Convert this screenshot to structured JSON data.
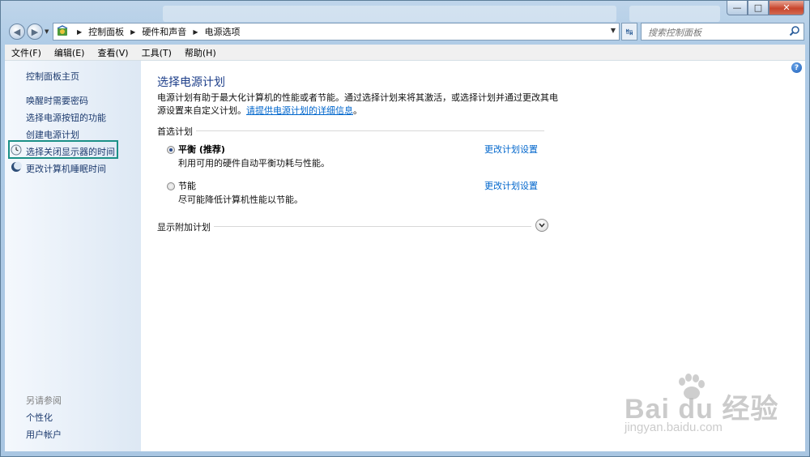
{
  "window": {
    "controls": {
      "minimize": "—",
      "maximize": "□",
      "close": "✕"
    }
  },
  "address": {
    "crumbs": [
      "控制面板",
      "硬件和声音",
      "电源选项"
    ],
    "search_placeholder": "搜索控制面板"
  },
  "menubar": [
    "文件(F)",
    "编辑(E)",
    "查看(V)",
    "工具(T)",
    "帮助(H)"
  ],
  "leftnav": {
    "home": "控制面板主页",
    "links": [
      "唤醒时需要密码",
      "选择电源按钮的功能",
      "创建电源计划",
      "选择关闭显示器的时间",
      "更改计算机睡眠时间"
    ],
    "see_also_title": "另请参阅",
    "see_also": [
      "个性化",
      "用户帐户"
    ]
  },
  "main": {
    "title": "选择电源计划",
    "description": "电源计划有助于最大化计算机的性能或者节能。通过选择计划来将其激活，或选择计划并通过更改其电源设置来自定义计划。",
    "more_info_link": "请提供电源计划的详细信息",
    "desc_end": "。",
    "preferred_label": "首选计划",
    "plans": [
      {
        "name": "平衡 (推荐)",
        "desc": "利用可用的硬件自动平衡功耗与性能。",
        "link": "更改计划设置",
        "selected": true
      },
      {
        "name": "节能",
        "desc": "尽可能降低计算机性能以节能。",
        "link": "更改计划设置",
        "selected": false
      }
    ],
    "additional_label": "显示附加计划"
  },
  "watermark": {
    "brand": "Bai du 经验",
    "url": "jingyan.baidu.com"
  },
  "colors": {
    "link": "#1c3a6e",
    "title": "#1e3f8a",
    "highlight_box": "#1b9087"
  }
}
